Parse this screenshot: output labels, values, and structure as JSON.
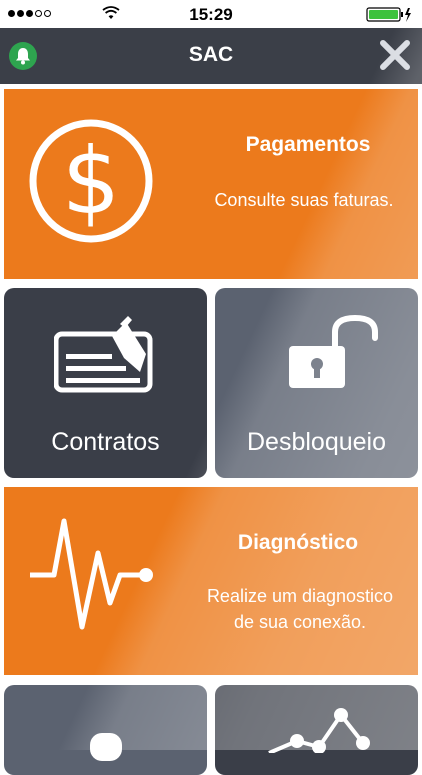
{
  "status_bar": {
    "time": "15:29",
    "signal_bars_filled": 3,
    "signal_bars_total": 5,
    "battery_level": 1.0
  },
  "nav": {
    "title": "SAC",
    "left_icon": "bell-icon",
    "right_icon": "close-icon"
  },
  "tiles": {
    "pagamentos": {
      "title": "Pagamentos",
      "description": "Consulte suas faturas.",
      "icon": "dollar-icon"
    },
    "contratos": {
      "label": "Contratos",
      "icon": "contract-pen-icon"
    },
    "desbloqueio": {
      "label": "Desbloqueio",
      "icon": "unlock-icon"
    },
    "diagnostico": {
      "title": "Diagnóstico",
      "description": "Realize um diagnostico de sua conexão.",
      "icon": "pulse-icon"
    },
    "bottom_left": {
      "icon": "user-icon"
    },
    "bottom_right": {
      "icon": "network-graph-icon"
    }
  },
  "colors": {
    "orange": "#ec7a1c",
    "dark": "#3a3e48",
    "slate": "#5b6270",
    "navbar": "#3b3f48",
    "bell_green": "#2ea44f"
  }
}
